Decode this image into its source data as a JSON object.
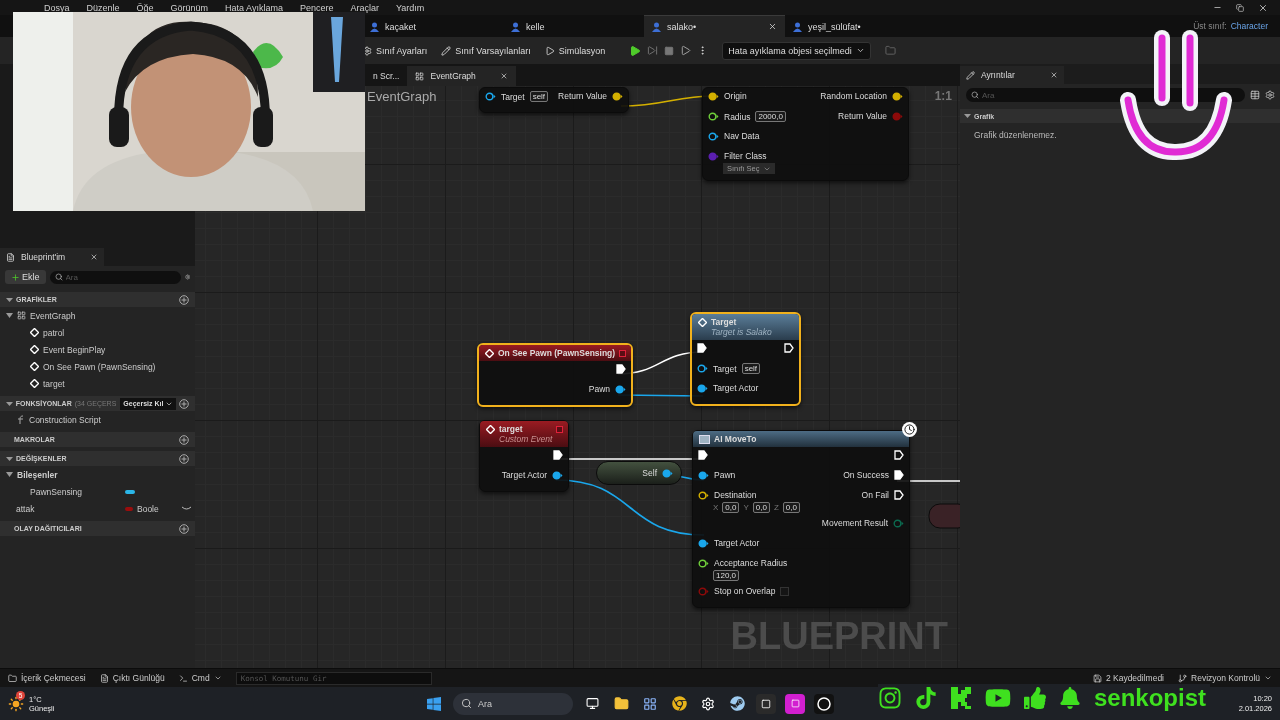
{
  "menu": [
    "Dosya",
    "Düzenle",
    "Öğe",
    "Görünüm",
    "Hata Ayıklama",
    "Pencere",
    "Araçlar",
    "Yardım"
  ],
  "parent_class": {
    "label": "Üst sınıf:",
    "value": "Character"
  },
  "asset_tabs": [
    {
      "label": "kaçaket",
      "selected": false
    },
    {
      "label": "kelle",
      "selected": false
    },
    {
      "label": "salako•",
      "selected": true
    },
    {
      "label": "yeşil_sülüfat•",
      "selected": false
    }
  ],
  "toolbar": {
    "buttons": [
      {
        "kind": "settings",
        "label": "Sınıf Ayarları"
      },
      {
        "kind": "defaults",
        "label": "Sınıf Varsayılanları"
      },
      {
        "kind": "simulate",
        "label": "Simülasyon"
      }
    ],
    "debug_select": "Hata ayıklama objesi seçilmedi"
  },
  "my_blueprint": {
    "title": "Blueprint'im",
    "add_button": "Ekle",
    "search": {
      "placeholder": "Ara"
    },
    "sections": [
      {
        "title": "GRAFİKLER",
        "expanded": true,
        "items": [
          {
            "kind": "graph",
            "label": "EventGraph",
            "expanded": true,
            "children": [
              {
                "kind": "event",
                "label": "patrol"
              },
              {
                "kind": "event",
                "label": "Event BeginPlay"
              },
              {
                "kind": "event",
                "label": "On See Pawn (PawnSensing)"
              },
              {
                "kind": "event",
                "label": "target"
              }
            ]
          }
        ]
      },
      {
        "title": "FONKSİYONLAR",
        "count": "(34 GEÇERS",
        "override_select": "Geçersiz Kıl",
        "expanded": true,
        "items": [
          {
            "kind": "function",
            "label": "Construction Script"
          }
        ]
      },
      {
        "title": "MAKROLAR",
        "expanded": false
      },
      {
        "title": "DEĞİŞKENLER",
        "expanded": true,
        "items": [
          {
            "kind": "category",
            "label": "Bileşenler",
            "expanded": true,
            "children": [
              {
                "kind": "component",
                "label": "PawnSensing",
                "color": "#2bb6e8"
              }
            ]
          },
          {
            "kind": "variable",
            "label": "attak",
            "type": "Boole",
            "color": "#9a0d0d"
          }
        ]
      },
      {
        "title": "OLAY DAĞITICILARI",
        "expanded": false
      }
    ]
  },
  "graph_tabs": [
    {
      "label": "n Scr...",
      "selected": false
    },
    {
      "label": "EventGraph",
      "selected": true
    }
  ],
  "graph": {
    "title": "EventGraph",
    "zoom_label": "1:1",
    "watermark": "BLUEPRINT",
    "nodes": [
      {
        "kind": "pure",
        "selected": false,
        "rows": [
          {
            "in": {
              "kind": "data",
              "color": "#1aa7ec",
              "label": "Target",
              "value": "self",
              "linked": false
            },
            "out": {
              "kind": "data",
              "color": "#d4b000",
              "label": "Return Value",
              "linked": true
            }
          }
        ]
      },
      {
        "kind": "pure",
        "selected": false,
        "rows": [
          {
            "in": {
              "kind": "data",
              "color": "#d4b000",
              "label": "Origin",
              "linked": true
            },
            "out": {
              "kind": "data",
              "color": "#d4b000",
              "label": "Random Location",
              "linked": true
            }
          },
          {
            "in": {
              "kind": "data",
              "color": "#6fce3a",
              "label": "Radius",
              "value": "2000,0",
              "linked": false
            },
            "out": {
              "kind": "data",
              "color": "#8c0a0a",
              "label": "Return Value",
              "linked": true
            }
          },
          {
            "in": {
              "kind": "data",
              "color": "#1aa7ec",
              "label": "Nav Data",
              "linked": false
            }
          },
          {
            "in": {
              "kind": "data",
              "color": "#5b1fb0",
              "label": "Filter Class",
              "select": "Sınıfı Seç",
              "linked": true
            }
          }
        ]
      },
      {
        "kind": "event",
        "selected": true,
        "title": "On See Pawn (PawnSensing)",
        "rows": [
          {
            "out": {
              "kind": "exec",
              "linked": true
            }
          },
          {
            "out": {
              "kind": "data",
              "color": "#1aa7ec",
              "label": "Pawn",
              "linked": true
            }
          }
        ]
      },
      {
        "kind": "function",
        "selected": true,
        "title": "Target",
        "subtitle": "Target is Salako",
        "rows": [
          {
            "in": {
              "kind": "exec",
              "linked": true
            },
            "out": {
              "kind": "exec",
              "linked": false
            }
          },
          {
            "in": {
              "kind": "data",
              "color": "#1aa7ec",
              "label": "Target",
              "value": "self",
              "linked": false
            }
          },
          {
            "in": {
              "kind": "data",
              "color": "#1aa7ec",
              "label": "Target Actor",
              "linked": true
            }
          }
        ]
      },
      {
        "kind": "event",
        "selected": false,
        "title": "target",
        "subtitle": "Custom Event",
        "rows": [
          {
            "out": {
              "kind": "exec",
              "linked": true
            }
          },
          {
            "out": {
              "kind": "data",
              "color": "#1aa7ec",
              "label": "Target Actor",
              "linked": true
            }
          }
        ]
      },
      {
        "kind": "reference",
        "selected": false,
        "rows": [
          {
            "out": {
              "kind": "data",
              "color": "#1aa7ec",
              "label": "Self",
              "linked": true
            }
          }
        ]
      },
      {
        "kind": "latent",
        "selected": false,
        "title": "AI MoveTo",
        "rows": [
          {
            "in": {
              "kind": "exec",
              "linked": true
            },
            "out": {
              "kind": "exec",
              "linked": false
            }
          },
          {
            "in": {
              "kind": "data",
              "color": "#1aa7ec",
              "label": "Pawn",
              "linked": true
            },
            "out": {
              "kind": "exec",
              "label": "On Success",
              "linked": true
            }
          },
          {
            "in": {
              "kind": "data",
              "color": "#d4b000",
              "label": "Destination",
              "linked": false,
              "fields": [
                {
                  "axis": "X",
                  "value": "0,0"
                },
                {
                  "axis": "Y",
                  "value": "0,0"
                },
                {
                  "axis": "Z",
                  "value": "0,0"
                }
              ]
            },
            "out": {
              "kind": "exec",
              "label": "On Fail",
              "linked": false
            }
          },
          {
            "out": {
              "kind": "data",
              "color": "#0b6a4f",
              "label": "Movement Result",
              "linked": false
            }
          },
          {
            "in": {
              "kind": "data",
              "color": "#1aa7ec",
              "label": "Target Actor",
              "linked": true
            }
          },
          {
            "in": {
              "kind": "data",
              "color": "#6fce3a",
              "label": "Acceptance Radius",
              "linked": false,
              "fields": [
                {
                  "value": "120,0"
                }
              ]
            }
          },
          {
            "in": {
              "kind": "data",
              "color": "#8c0a0a",
              "label": "Stop on Overlap",
              "linked": false,
              "checked": false
            }
          }
        ]
      }
    ]
  },
  "details": {
    "title": "Ayrıntılar",
    "search": {
      "placeholder": "Ara"
    },
    "section": {
      "title": "Grafik",
      "expanded": true
    },
    "message": "Grafik düzenlenemez."
  },
  "bottom_bar": {
    "content_drawer": "İçerik Çekmecesi",
    "output_log": "Çıktı Günlüğü",
    "cmd": "Cmd",
    "console": {
      "placeholder": "Konsol Komutunu Gir"
    },
    "unsaved": "2 Kaydedilmedi",
    "revision": "Revizyon Kontrolü"
  },
  "taskbar": {
    "weather": {
      "temp": "1°C",
      "condition": "Güneşli",
      "badge": "5"
    },
    "search": {
      "placeholder": "Ara"
    },
    "time": "10:20",
    "date": "2.01.2026"
  },
  "overlay": {
    "channel": "senkopist"
  }
}
